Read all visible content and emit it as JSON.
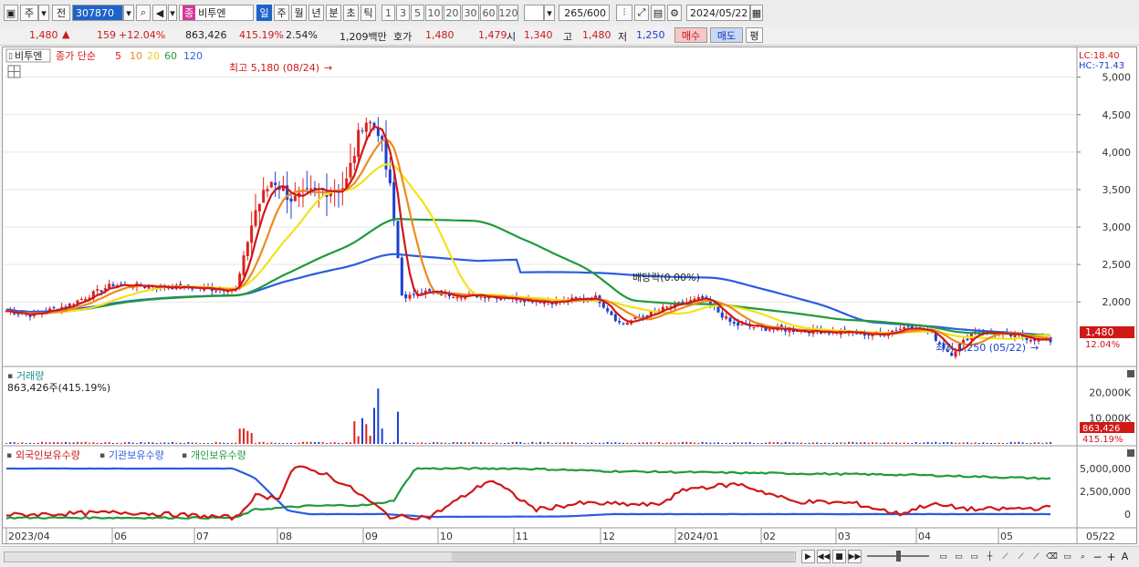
{
  "toolbar": {
    "market_label": "주",
    "prev_label": "전",
    "code": "307870",
    "name_prefix": "종",
    "stock_name": "비투엔",
    "periods": [
      "일",
      "주",
      "월",
      "년",
      "분",
      "초",
      "틱"
    ],
    "period_selected": "일",
    "numbers": [
      "1",
      "3",
      "5",
      "10",
      "20",
      "30",
      "60",
      "120"
    ],
    "count": "265",
    "count_total": "/600",
    "date": "2024/05/22"
  },
  "info": {
    "price": "1,480",
    "change_symbol": "▲",
    "change": "159",
    "change_pct": "+12.04%",
    "volume": "863,426",
    "volume_pct": "415.19%",
    "turnover": "2.54%",
    "amount": "1,209백만",
    "quote_label": "호가",
    "ask": "1,480",
    "bid": "1,479",
    "open_label": "시",
    "open": "1,340",
    "high_label": "고",
    "high": "1,480",
    "low_label": "저",
    "low": "1,250",
    "buy_label": "매수",
    "sell_label": "매도",
    "avg_label": "평"
  },
  "price_panel": {
    "name_tag": "비투엔",
    "legend_title": "종가 단순",
    "ma_labels": [
      "5",
      "10",
      "20",
      "60",
      "120"
    ],
    "lc": "LC:18.40",
    "hc": "HC:-71.43",
    "high_annotation": "최고 5,180 (08/24)",
    "low_annotation": "최저 1,250 (05/22)",
    "dividend_annotation": "배당락(0.00%)",
    "price_tag": "1,480",
    "pct_tag": "12.04%",
    "y_ticks": [
      "5,000",
      "4,500",
      "4,000",
      "3,500",
      "3,000",
      "2,500",
      "2,000"
    ]
  },
  "volume_panel": {
    "title": "거래량",
    "subtitle": "863,426주(415.19%)",
    "y_ticks": [
      "20,000K",
      "10,000K"
    ],
    "volume_tag": "863,426",
    "pct_tag": "415.19%"
  },
  "holding_panel": {
    "legend": [
      "외국인보유수량",
      "기관보유수량",
      "개인보유수량"
    ],
    "y_ticks": [
      "5,000,000",
      "2,500,000",
      "0"
    ]
  },
  "x_axis": [
    "2023/04",
    "06",
    "07",
    "08",
    "09",
    "10",
    "11",
    "12",
    "2024/01",
    "02",
    "03",
    "04",
    "05",
    "05/22"
  ],
  "colors": {
    "up": "#e0201b",
    "down": "#1c3fd0",
    "ma5": "#d01818",
    "ma10": "#ef8a1c",
    "ma20": "#f2e21a",
    "ma60": "#219a3c",
    "ma120": "#2a5ee0",
    "foreign": "#d01818",
    "institution": "#2a5ee0",
    "individual": "#219a3c"
  },
  "chart_data": {
    "type": "line",
    "x": [
      "2023/04",
      "06",
      "07",
      "08",
      "09",
      "10",
      "11",
      "12",
      "2024/01",
      "02",
      "03",
      "04",
      "05",
      "05/22"
    ],
    "series": [
      {
        "name": "5",
        "values": [
          1880,
          2250,
          2180,
          3550,
          3300,
          2100,
          2080,
          2050,
          1950,
          1700,
          1650,
          1600,
          1550,
          1480
        ]
      },
      {
        "name": "10",
        "values": [
          1900,
          2230,
          2170,
          3500,
          3450,
          2150,
          2080,
          2060,
          1980,
          1720,
          1660,
          1620,
          1570,
          1500
        ]
      },
      {
        "name": "20",
        "values": [
          1920,
          2200,
          2150,
          3200,
          3700,
          2200,
          2080,
          2070,
          2000,
          1750,
          1680,
          1650,
          1600,
          1530
        ]
      },
      {
        "name": "60",
        "values": [
          2150,
          2080,
          2120,
          2700,
          3200,
          3200,
          2800,
          2200,
          2020,
          1950,
          1900,
          1850,
          1800,
          1570
        ]
      },
      {
        "name": "120",
        "values": [
          2080,
          2060,
          2100,
          2450,
          2650,
          2680,
          2700,
          2630,
          2550,
          2300,
          2000,
          1850,
          1780,
          1720
        ]
      }
    ],
    "ylim": [
      1200,
      5300
    ],
    "extremes": {
      "high": 5180,
      "high_date": "08/24",
      "low": 1250,
      "low_date": "05/22"
    }
  }
}
